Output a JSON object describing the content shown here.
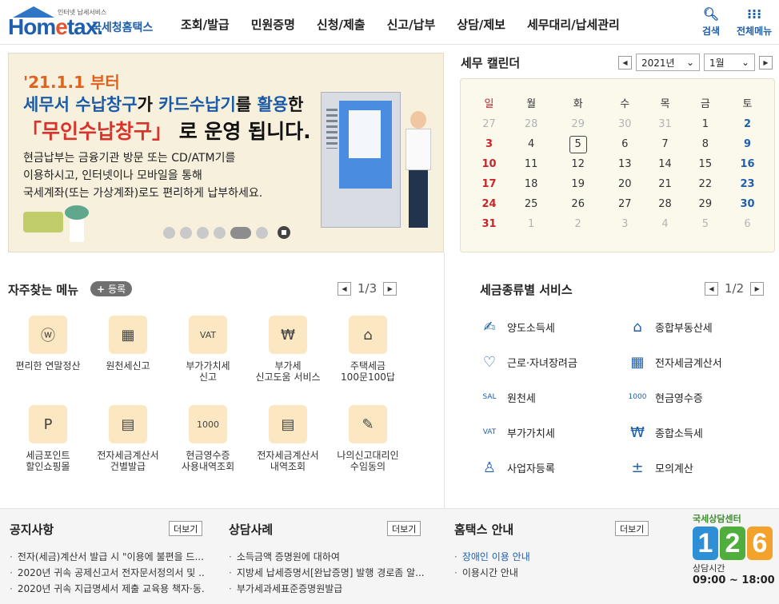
{
  "header": {
    "logo_small": "인터넷 납세서비스",
    "logo_word_a": "Hom",
    "logo_word_b": "e",
    "logo_word_c": "tax.",
    "logo_kr": "국세청홈택스",
    "nav": [
      "조회/발급",
      "민원증명",
      "신청/제출",
      "신고/납부",
      "상담/제보",
      "세무대리/납세관리"
    ],
    "search_label": "검색",
    "menu_label": "전체메뉴"
  },
  "banner": {
    "date_line": "'21.1.1 부터",
    "line1_a": "세무서 수납창구",
    "line1_b": "가 ",
    "line1_c": "카드수납기",
    "line1_d": "를 ",
    "line1_e": "활용",
    "line1_f": "한",
    "line2_a": "「무인수납창구」",
    "line2_b": " 로 운영 됩니다.",
    "body": [
      "현금납부는 금융기관 방문 또는 CD/ATM기를",
      "이용하시고, 인터넷이나 모바일을 통해",
      "국세계좌(또는 가상계좌)로도 편리하게 납부하세요."
    ],
    "slide_count": 6,
    "active_slide": 5
  },
  "calendar": {
    "title": "세무 캘린더",
    "year": "2021년",
    "month": "1월",
    "weekdays": [
      "일",
      "월",
      "화",
      "수",
      "목",
      "금",
      "토"
    ],
    "weeks": [
      [
        "27",
        "28",
        "29",
        "30",
        "31",
        "1",
        "2"
      ],
      [
        "3",
        "4",
        "5",
        "6",
        "7",
        "8",
        "9"
      ],
      [
        "10",
        "11",
        "12",
        "13",
        "14",
        "15",
        "16"
      ],
      [
        "17",
        "18",
        "19",
        "20",
        "21",
        "22",
        "23"
      ],
      [
        "24",
        "25",
        "26",
        "27",
        "28",
        "29",
        "30"
      ],
      [
        "31",
        "1",
        "2",
        "3",
        "4",
        "5",
        "6"
      ]
    ],
    "today": "5"
  },
  "frequent": {
    "title": "자주찾는 메뉴",
    "register": "등록",
    "page": "1/3",
    "items": [
      {
        "label": "편리한 연말정산",
        "icon": "ⓦ"
      },
      {
        "label": "원천세신고",
        "icon": "▦"
      },
      {
        "label": "부가가치세\n신고",
        "icon": "VAT"
      },
      {
        "label": "부가세\n신고도움 서비스",
        "icon": "₩"
      },
      {
        "label": "주택세금\n100문100답",
        "icon": "⌂"
      },
      {
        "label": "세금포인트\n할인쇼핑몰",
        "icon": "P"
      },
      {
        "label": "전자세금계산서\n건별발급",
        "icon": "▤"
      },
      {
        "label": "현금영수증\n사용내역조회",
        "icon": "1000"
      },
      {
        "label": "전자세금계산서\n내역조회",
        "icon": "▤"
      },
      {
        "label": "나의신고대리인\n수임동의",
        "icon": "✎"
      }
    ]
  },
  "taxservice": {
    "title": "세금종류별 서비스",
    "page": "1/2",
    "items": [
      {
        "label": "양도소득세",
        "icon": "✍"
      },
      {
        "label": "종합부동산세",
        "icon": "⌂"
      },
      {
        "label": "근로·자녀장려금",
        "icon": "♡"
      },
      {
        "label": "전자세금계산서",
        "icon": "▦"
      },
      {
        "label": "원천세",
        "icon": "SAL"
      },
      {
        "label": "현금영수증",
        "icon": "1000"
      },
      {
        "label": "부가가치세",
        "icon": "VAT"
      },
      {
        "label": "종합소득세",
        "icon": "₩"
      },
      {
        "label": "사업자등록",
        "icon": "♙"
      },
      {
        "label": "모의계산",
        "icon": "±"
      }
    ]
  },
  "notice": {
    "title": "공지사항",
    "more": "더보기",
    "items": [
      "전자(세금)계산서 발급 시 \"이용에 불편을 드...",
      "2020년 귀속 공제신고서 전자문서정의서 및 ...",
      "2020년 귀속 지급명세서 제출 교육용 책자·동..."
    ]
  },
  "consult": {
    "title": "상담사례",
    "more": "더보기",
    "items": [
      "소득금액 증명원에 대하여",
      "지방세 납세증명서[완납증명] 발행 경로좀 알...",
      "부가세과세표준증명원발급"
    ]
  },
  "guide": {
    "title": "홈택스 안내",
    "more": "더보기",
    "items": [
      "장애인 이용 안내",
      "이용시간 안내"
    ]
  },
  "callcenter": {
    "title": "국세상담센터",
    "digits": [
      "1",
      "2",
      "6"
    ],
    "hours_label": "상담시간",
    "hours": "09:00 ~ 18:00"
  },
  "colors": {
    "brand": "#1e5fae",
    "accent_orange": "#e0621f",
    "accent_red": "#d8342b"
  }
}
